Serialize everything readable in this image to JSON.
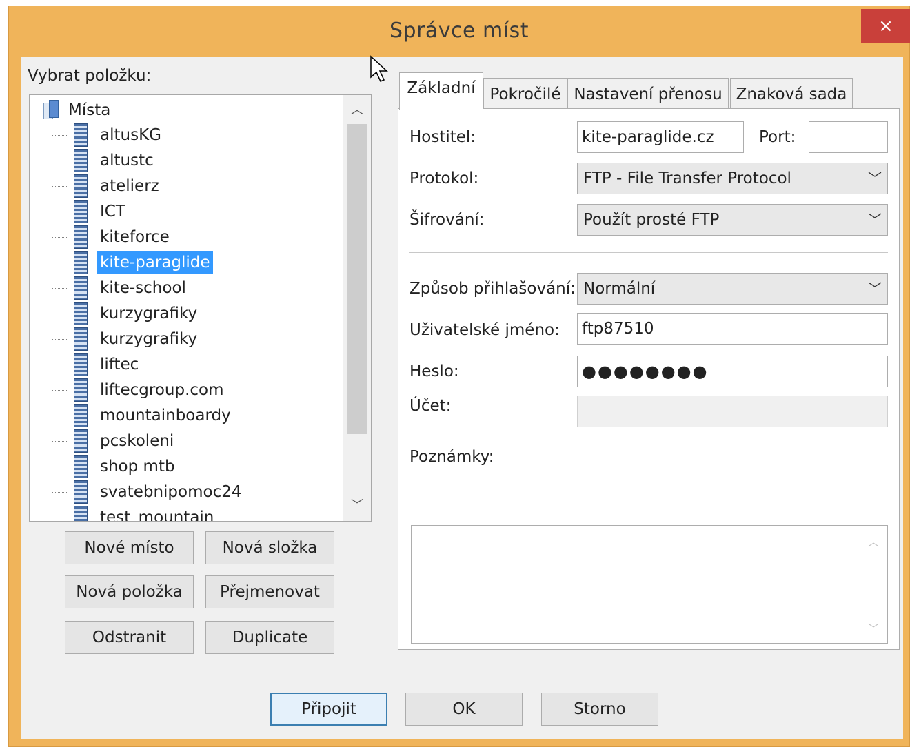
{
  "window": {
    "title": "Správce míst",
    "close_icon": "×"
  },
  "left": {
    "select_label": "Vybrat položku:",
    "tree": {
      "root": "Místa",
      "items": [
        {
          "label": "altusKG",
          "selected": false
        },
        {
          "label": "altustc",
          "selected": false
        },
        {
          "label": "atelierz",
          "selected": false
        },
        {
          "label": "ICT",
          "selected": false
        },
        {
          "label": "kiteforce",
          "selected": false
        },
        {
          "label": "kite-paraglide",
          "selected": true
        },
        {
          "label": "kite-school",
          "selected": false
        },
        {
          "label": "kurzygrafiky",
          "selected": false
        },
        {
          "label": "kurzygrafiky",
          "selected": false
        },
        {
          "label": "liftec",
          "selected": false
        },
        {
          "label": "liftecgroup.com",
          "selected": false
        },
        {
          "label": "mountainboardy",
          "selected": false
        },
        {
          "label": "pcskoleni",
          "selected": false
        },
        {
          "label": "shop mtb",
          "selected": false
        },
        {
          "label": "svatebnipomoc24",
          "selected": false
        },
        {
          "label": "test_mountain",
          "selected": false
        }
      ]
    },
    "buttons": {
      "new_site": "Nové místo",
      "new_folder": "Nová složka",
      "new_item": "Nová položka",
      "rename": "Přejmenovat",
      "delete": "Odstranit",
      "duplicate": "Duplicate"
    }
  },
  "tabs": [
    "Základní",
    "Pokročilé",
    "Nastavení přenosu",
    "Znaková sada"
  ],
  "form": {
    "host_label": "Hostitel:",
    "host_value": "kite-paraglide.cz",
    "port_label": "Port:",
    "port_value": "",
    "protocol_label": "Protokol:",
    "protocol_value": "FTP - File Transfer Protocol",
    "encryption_label": "Šifrování:",
    "encryption_value": "Použít prosté FTP",
    "logon_label": "Způsob přihlašování:",
    "logon_value": "Normální",
    "user_label": "Uživatelské jméno:",
    "user_value": "ftp87510",
    "password_label": "Heslo:",
    "password_value": "●●●●●●●●",
    "account_label": "Účet:",
    "account_value": "",
    "notes_label": "Poznámky:",
    "notes_value": ""
  },
  "footer": {
    "connect": "Připojit",
    "ok": "OK",
    "cancel": "Storno"
  }
}
